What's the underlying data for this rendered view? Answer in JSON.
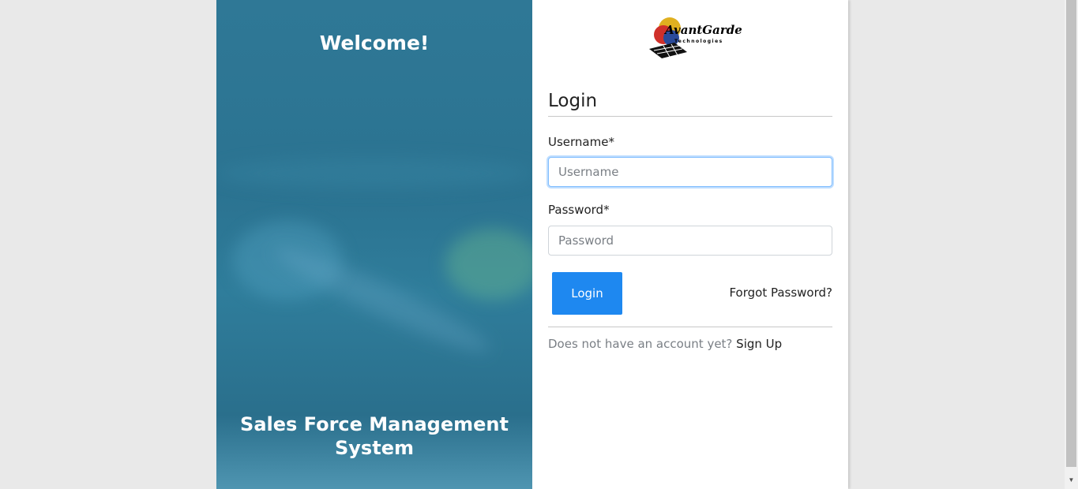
{
  "left_panel": {
    "welcome": "Welcome!",
    "system_title": "Sales Force Management System"
  },
  "logo": {
    "brand_text": "AvantGarde",
    "sub_text": "Technologies"
  },
  "login": {
    "heading": "Login",
    "username_label": "Username*",
    "username_placeholder": "Username",
    "username_value": "",
    "password_label": "Password*",
    "password_placeholder": "Password",
    "password_value": "",
    "login_button": "Login",
    "forgot_password": "Forgot Password?",
    "no_account_text": "Does not have an account yet?",
    "signup_link": "Sign Up"
  },
  "colors": {
    "accent": "#1e88f0",
    "panel": "#2b7391"
  }
}
